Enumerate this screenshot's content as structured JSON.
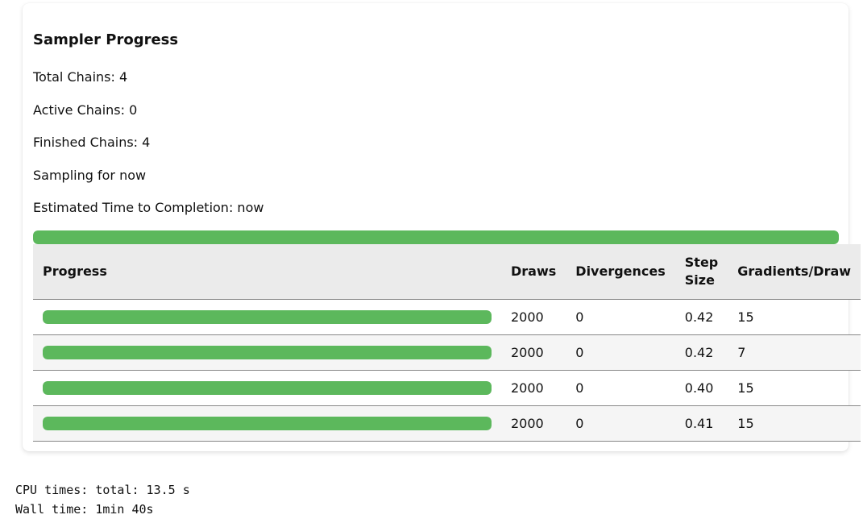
{
  "panel": {
    "title": "Sampler Progress",
    "total_chains": "Total Chains: 4",
    "active_chains": "Active Chains: 0",
    "finished_chains": "Finished Chains: 4",
    "sampling_for": "Sampling for now",
    "eta": "Estimated Time to Completion: now",
    "overall_progress": 1.0
  },
  "table": {
    "headers": {
      "progress": "Progress",
      "draws": "Draws",
      "divergences": "Divergences",
      "step_size_line1": "Step",
      "step_size_line2": "Size",
      "gradients": "Gradients/Draw"
    },
    "rows": [
      {
        "progress": 1.0,
        "draws": "2000",
        "divergences": "0",
        "step_size": "0.42",
        "gradients": "15"
      },
      {
        "progress": 1.0,
        "draws": "2000",
        "divergences": "0",
        "step_size": "0.42",
        "gradients": "7"
      },
      {
        "progress": 1.0,
        "draws": "2000",
        "divergences": "0",
        "step_size": "0.40",
        "gradients": "15"
      },
      {
        "progress": 1.0,
        "draws": "2000",
        "divergences": "0",
        "step_size": "0.41",
        "gradients": "15"
      }
    ]
  },
  "output": {
    "cpu_times": "CPU times: total: 13.5 s",
    "wall_time": "Wall time: 1min 40s"
  },
  "colors": {
    "progress_fill": "#5cb85c",
    "header_bg": "#ebebeb"
  }
}
